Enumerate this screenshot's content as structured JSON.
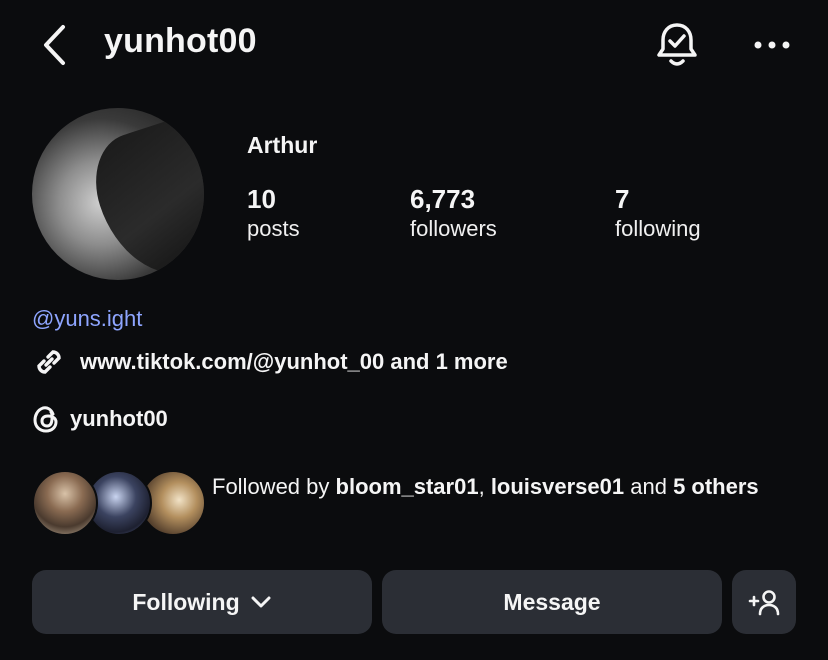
{
  "header": {
    "username": "yunhot00"
  },
  "profile": {
    "display_name": "Arthur",
    "stats": [
      {
        "value": "10",
        "label": "posts"
      },
      {
        "value": "6,773",
        "label": "followers"
      },
      {
        "value": "7",
        "label": "following"
      }
    ],
    "mention": "@yuns.ight",
    "link": "www.tiktok.com/@yunhot_00 and 1 more",
    "threads_handle": "yunhot00"
  },
  "followed_by": {
    "prefix": "Followed by ",
    "user1": "bloom_star01",
    "separator": ", ",
    "user2": "louisverse01",
    "connector": " and ",
    "others": "5 others"
  },
  "actions": {
    "following_label": "Following",
    "message_label": "Message"
  },
  "icons": {
    "back": "back-chevron-icon",
    "notifications": "bell-check-icon",
    "more": "more-horizontal-icon",
    "link": "link-icon",
    "threads": "threads-icon",
    "dropdown": "chevron-down-icon",
    "add_user": "add-user-icon"
  }
}
